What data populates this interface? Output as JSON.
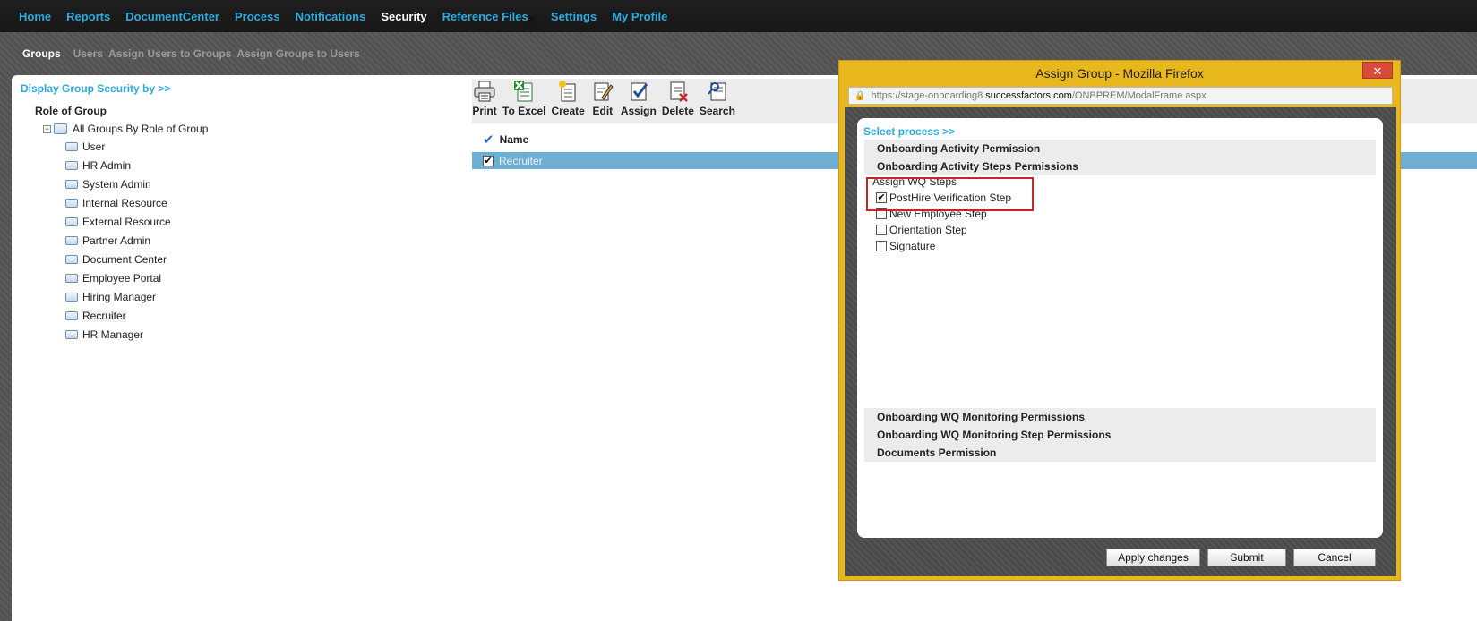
{
  "topnav": {
    "items": [
      "Home",
      "Reports",
      "DocumentCenter",
      "Process",
      "Notifications",
      "Security",
      "Reference Files",
      "Settings",
      "My Profile"
    ],
    "active": "Security"
  },
  "subnav": {
    "items": [
      "Groups",
      "Users",
      "Assign Users to Groups",
      "Assign Groups to Users"
    ],
    "active": "Groups"
  },
  "left_pane": {
    "display_by_link": "Display Group Security by >>",
    "heading": "Role of Group",
    "tree_root": "All Groups By Role of Group",
    "tree_items": [
      "User",
      "HR Admin",
      "System Admin",
      "Internal Resource",
      "External Resource",
      "Partner Admin",
      "Document Center",
      "Employee Portal",
      "Hiring Manager",
      "Recruiter",
      "HR Manager"
    ],
    "selected_item": "Recruiter"
  },
  "toolbar": {
    "buttons": [
      {
        "label": "Print",
        "icon": "printer-icon"
      },
      {
        "label": "To Excel",
        "icon": "excel-icon"
      },
      {
        "label": "Create",
        "icon": "create-icon"
      },
      {
        "label": "Edit",
        "icon": "edit-icon"
      },
      {
        "label": "Assign",
        "icon": "assign-icon"
      },
      {
        "label": "Delete",
        "icon": "delete-icon"
      },
      {
        "label": "Search",
        "icon": "search-icon"
      }
    ]
  },
  "grid": {
    "column": "Name",
    "rows": [
      {
        "name": "Recruiter",
        "checked": true
      }
    ]
  },
  "modal": {
    "title": "Assign Group - Mozilla Firefox",
    "close_glyph": "✕",
    "url_prefix": "https://stage-onboarding8.",
    "url_host": "successfactors.com",
    "url_path": "/ONBPREM/ModalFrame.aspx",
    "select_process_link": "Select process >>",
    "sections_top": [
      "Onboarding Activity Permission",
      "Onboarding Activity Steps Permissions"
    ],
    "steps_label": "Assign WQ Steps",
    "steps": [
      {
        "label": "PostHire Verification Step",
        "checked": true
      },
      {
        "label": "New Employee Step",
        "checked": false
      },
      {
        "label": "Orientation Step",
        "checked": false
      },
      {
        "label": "Signature",
        "checked": false
      }
    ],
    "sections_bottom": [
      "Onboarding WQ Monitoring Permissions",
      "Onboarding WQ Monitoring Step Permissions",
      "Documents Permission"
    ],
    "buttons": {
      "apply": "Apply changes",
      "submit": "Submit",
      "cancel": "Cancel"
    }
  },
  "colors": {
    "nav_link": "#2eaadc",
    "nav_active": "#ffffff",
    "selected_row": "#6faed3",
    "modal_frame": "#e8b71c",
    "highlight_box": "#c8242a"
  }
}
